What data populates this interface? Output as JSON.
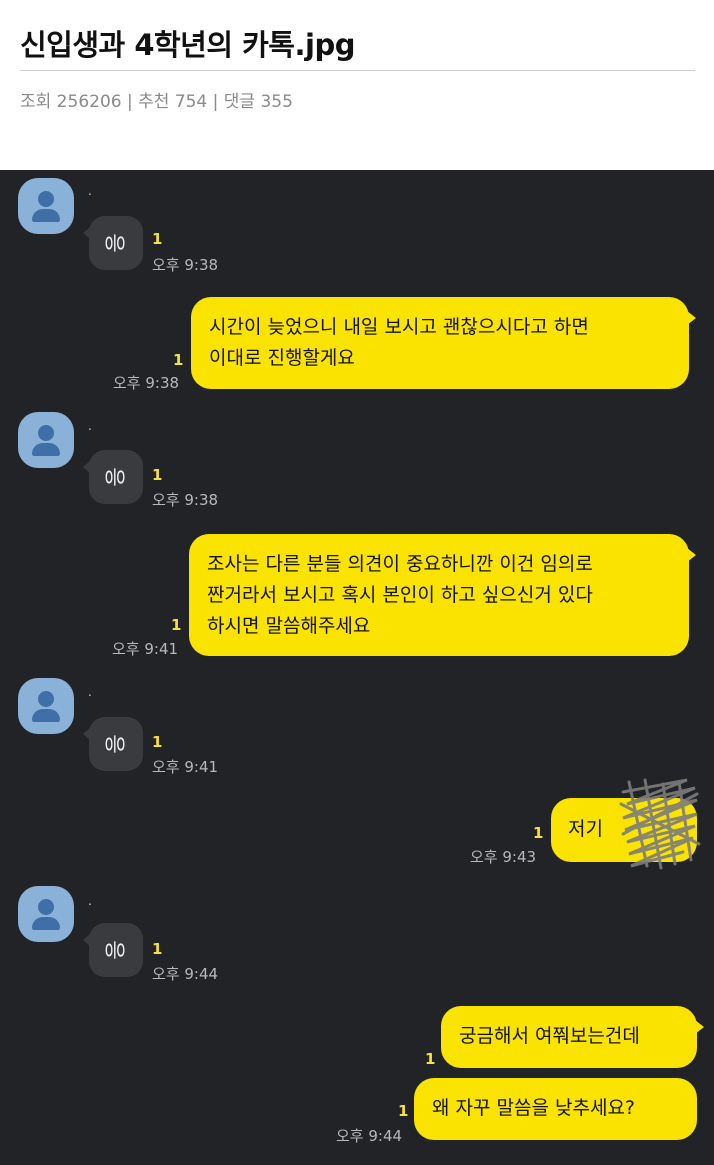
{
  "post": {
    "title": "신입생과 4학년의 카톡.jpg",
    "meta": "조회 256206 | 추천 754 | 댓글 355"
  },
  "chat": {
    "sender_name": ".",
    "messages": [
      {
        "dir": "in",
        "text": "응",
        "read": "1",
        "time": "오후 9:38"
      },
      {
        "dir": "out",
        "lines": [
          "시간이 늦었으니 내일 보시고 괜찮으시다고 하면",
          "이대로 진행할게요"
        ],
        "read": "1",
        "time": "오후 9:38"
      },
      {
        "dir": "in",
        "text": "응",
        "read": "1",
        "time": "오후 9:38"
      },
      {
        "dir": "out",
        "lines": [
          "조사는 다른 분들 의견이 중요하니깐 이건 임의로",
          "짠거라서 보시고 혹시 본인이 하고 싶으신거 있다",
          "하시면 말씀해주세요"
        ],
        "read": "1",
        "time": "오후 9:41"
      },
      {
        "dir": "in",
        "text": "응",
        "read": "1",
        "time": "오후 9:41"
      },
      {
        "dir": "out",
        "lines": [
          "저기"
        ],
        "read": "1",
        "time": "오후 9:43",
        "redacted": true
      },
      {
        "dir": "in",
        "text": "응",
        "read": "1",
        "time": "오후 9:44"
      },
      {
        "dir": "out",
        "lines": [
          "궁금해서 여쭤보는건데"
        ],
        "read": "1",
        "time": ""
      },
      {
        "dir": "out",
        "lines": [
          "왜 자꾸 말씀을 낮추세요?"
        ],
        "read": "1",
        "time": "오후 9:44"
      }
    ]
  },
  "colors": {
    "chat_background": "#222326",
    "my_bubble": "#fbe300",
    "their_bubble": "#3a3b3e",
    "unread_count": "#f6e23a",
    "avatar": "#8ab2d8"
  },
  "icons": {
    "avatar": "default-profile-icon"
  }
}
